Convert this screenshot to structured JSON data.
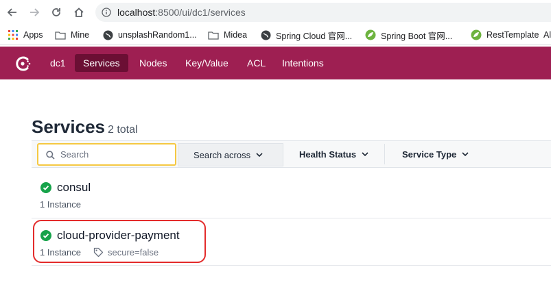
{
  "browser": {
    "url_host": "localhost",
    "url_path": ":8500/ui/dc1/services"
  },
  "bookmarks": [
    {
      "label": "Apps",
      "icon": "apps-grid-icon"
    },
    {
      "label": "Mine",
      "icon": "folder-icon"
    },
    {
      "label": "unsplashRandom1...",
      "icon": "globe-icon"
    },
    {
      "label": "Midea",
      "icon": "folder-icon"
    },
    {
      "label": "Spring Cloud 官网...",
      "icon": "globe-icon"
    },
    {
      "label": "Spring Boot 官网...",
      "icon": "spring-leaf-icon"
    },
    {
      "label": "RestTemplate",
      "icon": "spring-leaf-icon"
    },
    {
      "label": "Al",
      "icon": ""
    }
  ],
  "header": {
    "datacenter": "dc1",
    "nav": [
      "Services",
      "Nodes",
      "Key/Value",
      "ACL",
      "Intentions"
    ],
    "active": "Services"
  },
  "page": {
    "title": "Services",
    "count": "2 total"
  },
  "toolbar": {
    "search_placeholder": "Search",
    "search_across": "Search across",
    "health_status": "Health Status",
    "service_type": "Service Type"
  },
  "services": [
    {
      "name": "consul",
      "instances": "1 Instance",
      "tag": ""
    },
    {
      "name": "cloud-provider-payment",
      "instances": "1 Instance",
      "tag": "secure=false"
    }
  ],
  "colors": {
    "header_bg": "#9e1f52",
    "nav_active_bg": "#6b0f34",
    "health_passing": "#16a34a",
    "search_focus": "#f5c842",
    "highlight_ring": "#e32b2b"
  }
}
